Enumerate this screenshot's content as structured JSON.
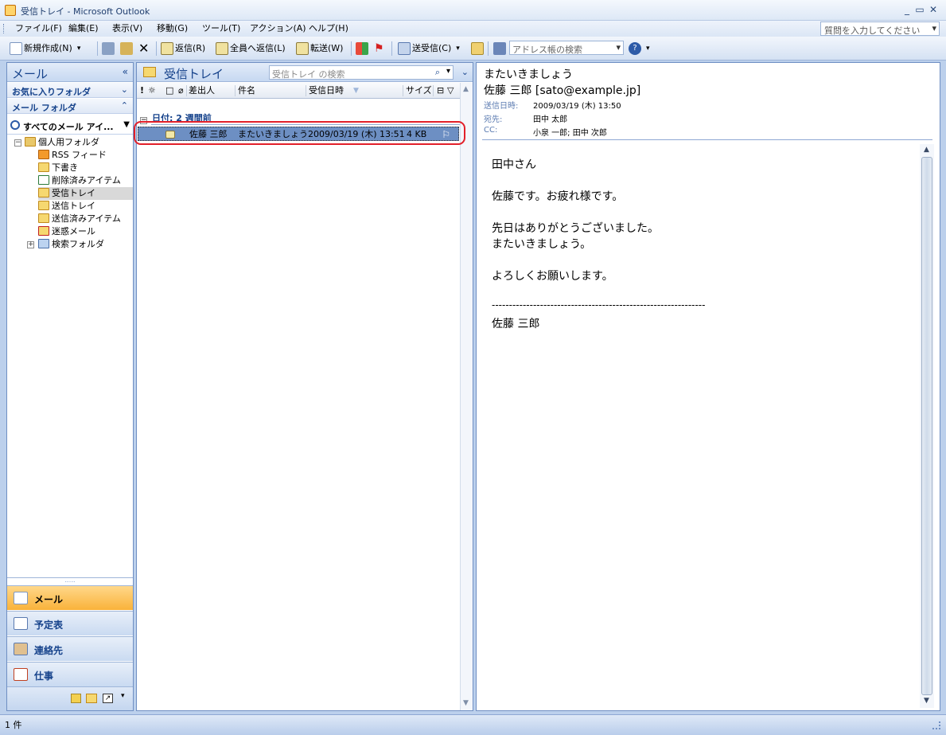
{
  "window": {
    "title": "受信トレイ - Microsoft Outlook"
  },
  "menu": [
    "ファイル(F)",
    "編集(E)",
    "表示(V)",
    "移動(G)",
    "ツール(T)",
    "アクション(A)",
    "ヘルプ(H)"
  ],
  "help_search_placeholder": "質問を入力してください",
  "toolbar": {
    "new": "新規作成(N)",
    "reply": "返信(R)",
    "reply_all": "全員へ返信(L)",
    "forward": "転送(W)",
    "send_receive": "送受信(C)",
    "address_search_placeholder": "アドレス帳の検索"
  },
  "nav": {
    "header": "メール",
    "favorites": "お気に入りフォルダ",
    "mail_folders": "メール フォルダ",
    "all_mail": "すべてのメール アイ...",
    "tree": [
      {
        "label": "個人用フォルダ"
      },
      {
        "label": "RSS フィード"
      },
      {
        "label": "下書き"
      },
      {
        "label": "削除済みアイテム"
      },
      {
        "label": "受信トレイ"
      },
      {
        "label": "送信トレイ"
      },
      {
        "label": "送信済みアイテム"
      },
      {
        "label": "迷惑メール"
      },
      {
        "label": "検索フォルダ"
      }
    ],
    "buttons": [
      {
        "label": "メール"
      },
      {
        "label": "予定表"
      },
      {
        "label": "連絡先"
      },
      {
        "label": "仕事"
      }
    ]
  },
  "list": {
    "title": "受信トレイ",
    "search_placeholder": "受信トレイ の検索",
    "columns": {
      "sender": "差出人",
      "subject": "件名",
      "received": "受信日時",
      "size": "サイズ"
    },
    "group": "日付: 2 週間前",
    "messages": [
      {
        "sender": "佐藤 三郎",
        "subject": "またいきましょう",
        "received": "2009/03/19 (木) 13:51",
        "size": "4 KB"
      }
    ]
  },
  "reading": {
    "subject": "またいきましょう",
    "sender": "佐藤 三郎 [sato@example.jp]",
    "sent_label": "送信日時:",
    "sent_value": "2009/03/19 (木) 13:50",
    "to_label": "宛先:",
    "to_value": "田中 太郎",
    "cc_label": "CC:",
    "cc_value": "小泉 一郎; 田中 次郎",
    "body": [
      "田中さん",
      "佐藤です。お疲れ様です。",
      "先日はありがとうございました。",
      "またいきましょう。",
      "よろしくお願いします。",
      "--------------------------------------------------------------",
      "佐藤 三郎"
    ]
  },
  "status": {
    "count": "1 件"
  }
}
